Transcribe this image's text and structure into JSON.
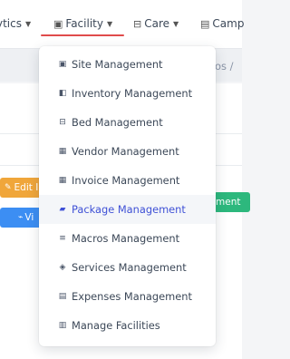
{
  "navbar": {
    "items": [
      {
        "label": "ytics",
        "icon": "",
        "has_caret": true
      },
      {
        "label": "Facility",
        "icon": "building-icon",
        "has_caret": true
      },
      {
        "label": "Care",
        "icon": "bed-icon",
        "has_caret": true
      },
      {
        "label": "Camp",
        "icon": "briefcase-icon",
        "has_caret": false
      }
    ],
    "active_item": "Facility",
    "active_color": "#e04b4b"
  },
  "breadcrumb": {
    "tail": "os  /"
  },
  "buttons": {
    "edit_label": "Edit I",
    "view_label": "Vi",
    "green_label": "ment"
  },
  "dropdown": {
    "items": [
      {
        "label": "Site Management",
        "icon": "building-icon"
      },
      {
        "label": "Inventory Management",
        "icon": "inventory-icon"
      },
      {
        "label": "Bed Management",
        "icon": "bed-icon"
      },
      {
        "label": "Vendor Management",
        "icon": "vendor-icon"
      },
      {
        "label": "Invoice Management",
        "icon": "invoice-icon"
      },
      {
        "label": "Package Management",
        "icon": "package-icon",
        "active": true
      },
      {
        "label": "Macros Management",
        "icon": "macros-icon"
      },
      {
        "label": "Services Management",
        "icon": "layers-icon"
      },
      {
        "label": "Expenses Management",
        "icon": "receipt-icon"
      },
      {
        "label": "Manage Facilities",
        "icon": "clipboard-icon"
      }
    ],
    "active_color": "#3f51d6"
  }
}
